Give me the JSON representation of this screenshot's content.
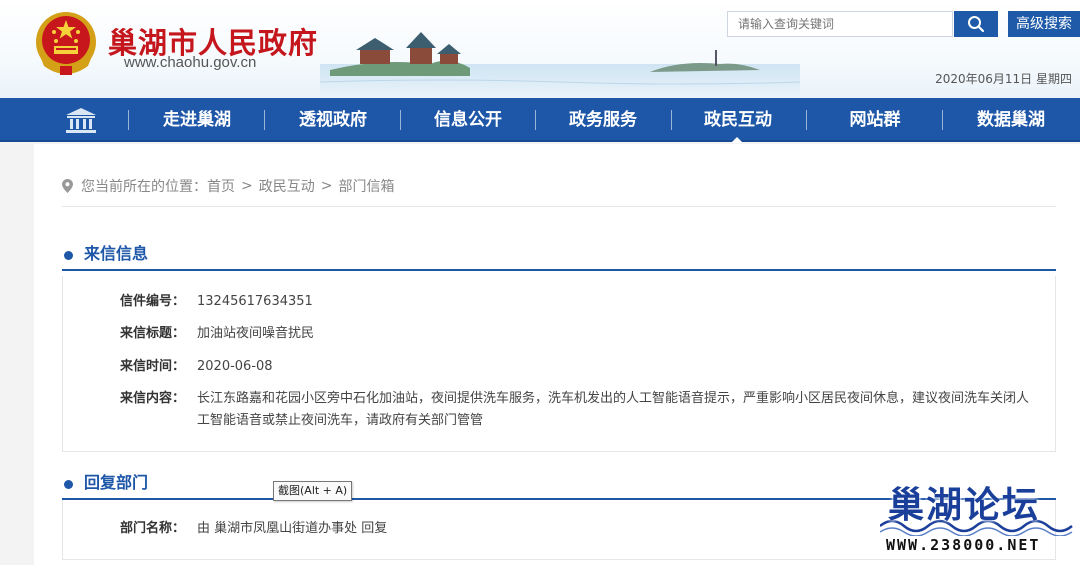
{
  "header": {
    "site_name": "巢湖市人民政府",
    "site_url": "www.chaohu.gov.cn",
    "search_placeholder": "请输入查询关键词",
    "advanced_search_label": "高级搜索",
    "date": "2020年06月11日 星期四"
  },
  "nav": {
    "home_icon": "building-icon",
    "items": [
      {
        "label": "走进巢湖"
      },
      {
        "label": "透视政府"
      },
      {
        "label": "信息公开"
      },
      {
        "label": "政务服务"
      },
      {
        "label": "政民互动",
        "active": true
      },
      {
        "label": "网站群"
      },
      {
        "label": "数据巢湖"
      }
    ]
  },
  "breadcrumb": {
    "prefix": "您当前所在的位置：",
    "items": [
      "首页",
      "政民互动",
      "部门信箱"
    ],
    "separator": ">"
  },
  "letter": {
    "section_title": "来信信息",
    "fields": [
      {
        "label": "信件编号：",
        "value": "13245617634351"
      },
      {
        "label": "来信标题：",
        "value": "加油站夜间噪音扰民"
      },
      {
        "label": "来信时间：",
        "value": "2020-06-08"
      },
      {
        "label": "来信内容：",
        "value": "长江东路嘉和花园小区旁中石化加油站，夜间提供洗车服务，洗车机发出的人工智能语音提示，严重影响小区居民夜间休息，建议夜间洗车关闭人工智能语音或禁止夜间洗车，请政府有关部门管管"
      }
    ]
  },
  "reply": {
    "section_title": "回复部门",
    "fields": [
      {
        "label": "部门名称：",
        "value": "由 巢湖市凤凰山街道办事处 回复"
      }
    ]
  },
  "tooltip": "截图(Alt + A)",
  "watermark": {
    "title": "巢湖论坛",
    "url": "WWW.238000.NET"
  },
  "colors": {
    "brand_red": "#c4161c",
    "nav_blue": "#1f57a8",
    "watermark_blue": "#1a3f9a"
  }
}
